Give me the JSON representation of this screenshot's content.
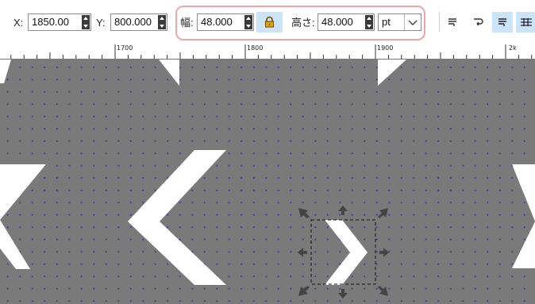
{
  "toolbar": {
    "x_label": "X:",
    "x_value": "1850.00",
    "y_label": "Y:",
    "y_value": "800.000",
    "width_label": "幅:",
    "width_value": "48.000",
    "height_label": "高さ:",
    "height_value": "48.000",
    "unit": "pt",
    "lock_icon": "lock-icon",
    "align_buttons": [
      "snap-left-icon",
      "snap-right-icon",
      "snap-active-icon",
      "grid-icon"
    ]
  },
  "ruler": {
    "labels": [
      "1700",
      "1800",
      "1900",
      "2k"
    ]
  },
  "colors": {
    "canvas": "#7a7a7a",
    "grid_dot": "#3a3aa8",
    "selection_highlight": "#cce4f7",
    "annotation_border": "#e9a8a8",
    "shape": "#ffffff"
  }
}
